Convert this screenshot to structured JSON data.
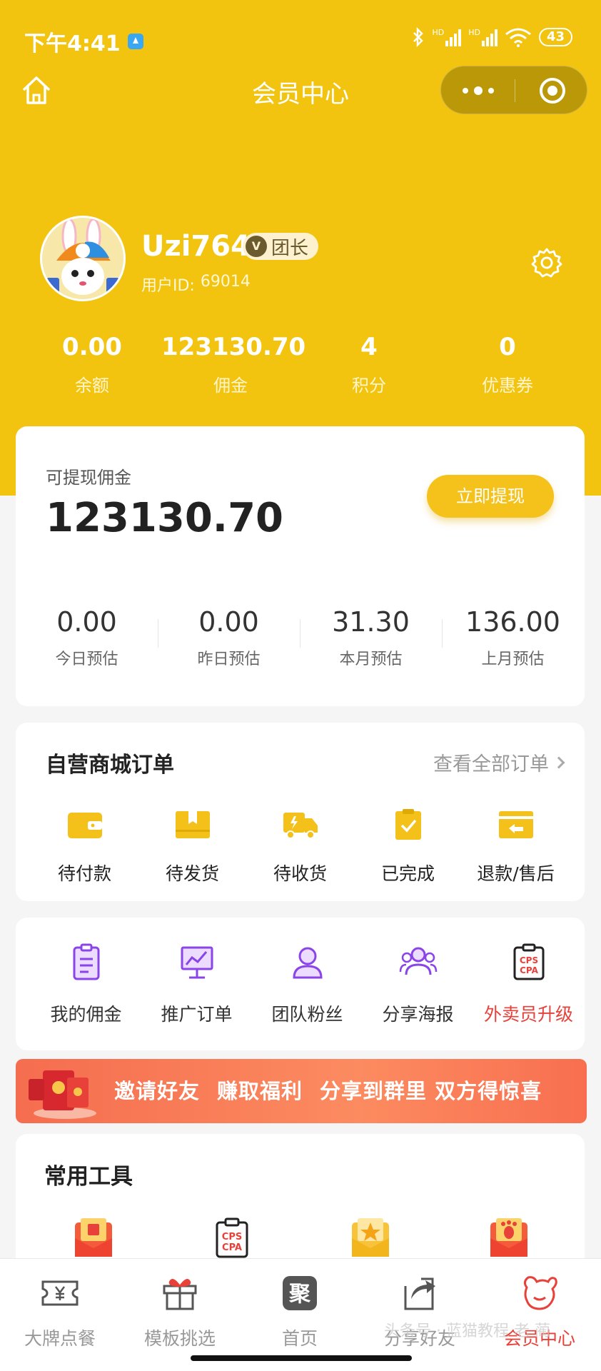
{
  "status_bar": {
    "time": "下午4:41",
    "network_labels": [
      "HD",
      "HD"
    ],
    "battery": "43"
  },
  "nav": {
    "title": "会员中心"
  },
  "profile": {
    "username": "Uzi764",
    "level_icon_text": "V",
    "level_badge": "团长",
    "user_id_label": "用户ID:",
    "user_id": "69014"
  },
  "stats": [
    {
      "value": "0.00",
      "label": "余额"
    },
    {
      "value": "123130.70",
      "label": "佣金"
    },
    {
      "value": "4",
      "label": "积分"
    },
    {
      "value": "0",
      "label": "优惠券"
    }
  ],
  "withdraw": {
    "label": "可提现佣金",
    "amount": "123130.70",
    "button": "立即提现",
    "estimates": [
      {
        "value": "0.00",
        "label": "今日预估"
      },
      {
        "value": "0.00",
        "label": "昨日预估"
      },
      {
        "value": "31.30",
        "label": "本月预估"
      },
      {
        "value": "136.00",
        "label": "上月预估"
      }
    ]
  },
  "orders": {
    "title": "自营商城订单",
    "view_all": "查看全部订单",
    "items": [
      {
        "label": "待付款",
        "icon": "wallet-icon"
      },
      {
        "label": "待发货",
        "icon": "package-icon"
      },
      {
        "label": "待收货",
        "icon": "truck-icon"
      },
      {
        "label": "已完成",
        "icon": "clipboard-check-icon"
      },
      {
        "label": "退款/售后",
        "icon": "refund-icon"
      }
    ]
  },
  "functions": [
    {
      "label": "我的佣金",
      "icon": "commission-icon"
    },
    {
      "label": "推广订单",
      "icon": "chart-board-icon"
    },
    {
      "label": "团队粉丝",
      "icon": "user-icon"
    },
    {
      "label": "分享海报",
      "icon": "group-icon"
    },
    {
      "label": "外卖员升级",
      "icon": "cps-cpa-icon"
    }
  ],
  "banner": {
    "parts": [
      "邀请好友",
      "赚取福利",
      "分享到群里 双方得惊喜"
    ]
  },
  "tools": {
    "title": "常用工具",
    "cps_text": [
      "CPS",
      "CPA"
    ],
    "items": [
      {
        "icon": "red-envelope-book-icon"
      },
      {
        "icon": "cps-cpa-icon"
      },
      {
        "icon": "yellow-envelope-star-icon"
      },
      {
        "icon": "red-envelope-foot-icon"
      }
    ]
  },
  "tab_bar": {
    "items": [
      {
        "label": "大牌点餐",
        "icon": "ticket-yen-icon"
      },
      {
        "label": "模板挑选",
        "icon": "gift-icon"
      },
      {
        "label": "首页",
        "icon": "home-ju-icon",
        "icon_text": "聚"
      },
      {
        "label": "分享好友",
        "icon": "share-icon"
      },
      {
        "label": "会员中心",
        "icon": "member-icon",
        "active": true
      }
    ]
  },
  "watermark": "头条号 · 蓝猫教程 老 蔺",
  "colors": {
    "brand_yellow": "#f2c40f",
    "button_yellow": "#f4c21b",
    "accent_red": "#e8413a",
    "background": "#f5f5f5"
  }
}
